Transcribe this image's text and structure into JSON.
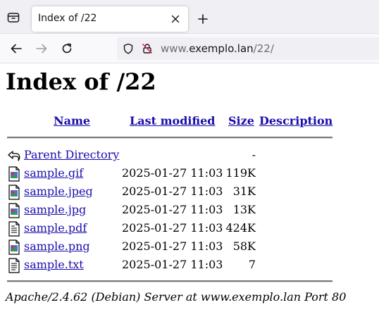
{
  "browser": {
    "tab_title": "Index of /22",
    "url_host_prefix": "www.",
    "url_host": "exemplo.lan",
    "url_path": "/22/"
  },
  "page": {
    "title": "Index of /22",
    "headers": {
      "name": "Name",
      "last_modified": "Last modified",
      "size": "Size",
      "description": "Description"
    },
    "parent": {
      "name": "Parent Directory",
      "size": "-",
      "icon": "back-icon"
    },
    "files": [
      {
        "name": "sample.gif",
        "date": "2025-01-27 11:03",
        "size": "119K",
        "icon": "image-icon"
      },
      {
        "name": "sample.jpeg",
        "date": "2025-01-27 11:03",
        "size": "31K",
        "icon": "image-icon"
      },
      {
        "name": "sample.jpg",
        "date": "2025-01-27 11:03",
        "size": "13K",
        "icon": "image-icon"
      },
      {
        "name": "sample.pdf",
        "date": "2025-01-27 11:03",
        "size": "424K",
        "icon": "document-icon"
      },
      {
        "name": "sample.png",
        "date": "2025-01-27 11:03",
        "size": "58K",
        "icon": "image-icon"
      },
      {
        "name": "sample.txt",
        "date": "2025-01-27 11:03",
        "size": "7",
        "icon": "text-file-icon"
      }
    ],
    "footer": "Apache/2.4.62 (Debian) Server at www.exemplo.lan Port 80"
  },
  "colors": {
    "link": "#1a0dab",
    "chrome_bg": "#f0f0f4",
    "navbar_bg": "#f9f9fb"
  }
}
